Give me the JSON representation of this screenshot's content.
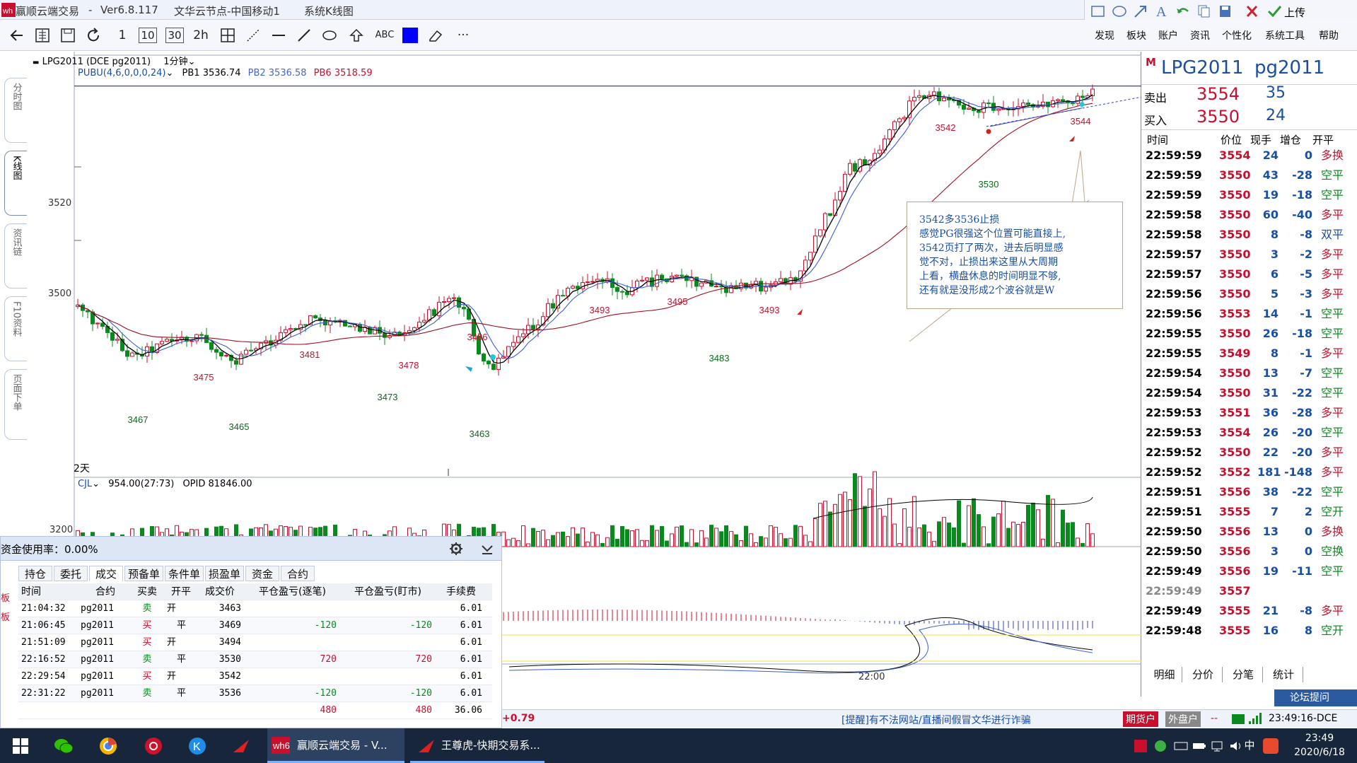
{
  "window": {
    "app_title": "赢顺云端交易",
    "separator": "-",
    "version": "Ver6.8.117",
    "node": "文华云节点-中国移动1",
    "view": "系统K线图"
  },
  "toolbar": {
    "buttons": [
      "1",
      "10",
      "30",
      "2h"
    ],
    "abc": "ABC",
    "more": "···",
    "menus": [
      "发现",
      "板块",
      "账户",
      "资讯",
      "个性化",
      "系统工具",
      "帮助"
    ],
    "upload": "上传"
  },
  "left_tabs": [
    "分时图",
    "K线图",
    "资讯链",
    "F10资料",
    "页面下单"
  ],
  "chart_header": {
    "symbol": "LPG2011 (DCE pg2011)",
    "period": "1分钟",
    "indicator": "PUBU(4,6,0,0,0,24)",
    "pb1": "PB1 3536.74",
    "pb2": "PB2 3536.58",
    "pb6": "PB6 3518.59",
    "days": "2天",
    "cjl": "CJL",
    "cjl_value": "954.00(27:73)",
    "opid": "OPID 81846.00",
    "y_3520": "3520",
    "y_3500": "3500",
    "vol_label": "3200",
    "time_label": "22:00"
  },
  "annotation": {
    "lines": [
      "3542多3536止损",
      "感觉PG很强这个位置可能直接上,",
      "3542页打了两次，进去后明显感",
      "觉不对，止损出来这里从大周期",
      "上看，横盘休息的时间明显不够,",
      "还有就是没形成2个波谷就是W"
    ]
  },
  "chart_data": {
    "type": "candlestick",
    "y_axis_ticks": [
      3500,
      3520
    ],
    "x_axis_ticks": [
      "22:00"
    ],
    "labeled_points": [
      {
        "label": "3467",
        "kind": "low"
      },
      {
        "label": "3475",
        "kind": "high"
      },
      {
        "label": "3465",
        "kind": "low"
      },
      {
        "label": "3481",
        "kind": "high"
      },
      {
        "label": "3473",
        "kind": "low"
      },
      {
        "label": "3478",
        "kind": "high"
      },
      {
        "label": "3486",
        "kind": "high"
      },
      {
        "label": "3463",
        "kind": "low"
      },
      {
        "label": "3493",
        "kind": "high"
      },
      {
        "label": "3495",
        "kind": "high"
      },
      {
        "label": "3483",
        "kind": "low"
      },
      {
        "label": "3493",
        "kind": "high"
      },
      {
        "label": "3542",
        "kind": "high"
      },
      {
        "label": "3530",
        "kind": "low"
      },
      {
        "label": "3544",
        "kind": "high"
      }
    ],
    "reference_line": 3542
  },
  "quote": {
    "market": "M",
    "name": "LPG2011",
    "code": "pg2011",
    "ask_label": "卖出",
    "ask_price": "3554",
    "ask_vol": "35",
    "bid_label": "买入",
    "bid_price": "3550",
    "bid_vol": "24",
    "cols": [
      "时间",
      "价位",
      "现手",
      "增仓",
      "开平"
    ],
    "ticks": [
      [
        "22:59:59",
        "3554",
        "24",
        "0",
        "多换"
      ],
      [
        "22:59:59",
        "3550",
        "43",
        "-28",
        "空平"
      ],
      [
        "22:59:59",
        "3550",
        "19",
        "-18",
        "空平"
      ],
      [
        "22:59:58",
        "3550",
        "60",
        "-40",
        "多平"
      ],
      [
        "22:59:58",
        "3550",
        "8",
        "-8",
        "双平"
      ],
      [
        "22:59:57",
        "3550",
        "3",
        "-2",
        "多平"
      ],
      [
        "22:59:57",
        "3550",
        "6",
        "-5",
        "多平"
      ],
      [
        "22:59:56",
        "3550",
        "5",
        "-3",
        "多平"
      ],
      [
        "22:59:56",
        "3553",
        "14",
        "-1",
        "空平"
      ],
      [
        "22:59:55",
        "3550",
        "26",
        "-18",
        "空平"
      ],
      [
        "22:59:55",
        "3549",
        "8",
        "-1",
        "多平"
      ],
      [
        "22:59:54",
        "3550",
        "13",
        "-7",
        "空平"
      ],
      [
        "22:59:54",
        "3550",
        "31",
        "-22",
        "空平"
      ],
      [
        "22:59:53",
        "3551",
        "36",
        "-28",
        "多平"
      ],
      [
        "22:59:53",
        "3554",
        "26",
        "-20",
        "空平"
      ],
      [
        "22:59:52",
        "3550",
        "22",
        "-20",
        "多平"
      ],
      [
        "22:59:52",
        "3552",
        "181",
        "-148",
        "多平"
      ],
      [
        "22:59:51",
        "3556",
        "38",
        "-22",
        "空平"
      ],
      [
        "22:59:51",
        "3555",
        "7",
        "2",
        "空开"
      ],
      [
        "22:59:50",
        "3556",
        "13",
        "0",
        "多换"
      ],
      [
        "22:59:50",
        "3556",
        "3",
        "0",
        "空换"
      ],
      [
        "22:59:49",
        "3556",
        "19",
        "-11",
        "空平"
      ],
      [
        "22:59:49",
        "3557",
        "",
        "",
        ""
      ],
      [
        "22:59:49",
        "3555",
        "21",
        "-8",
        "多平"
      ],
      [
        "22:59:48",
        "3555",
        "16",
        "8",
        "空开"
      ]
    ],
    "tabs": [
      "明细",
      "分价",
      "分笔",
      "统计"
    ]
  },
  "account_panel": {
    "usage": "资金使用率：0.00%",
    "tabs": [
      "持仓",
      "委托",
      "成交",
      "预备单",
      "条件单",
      "损盈单",
      "资金",
      "合约"
    ],
    "cols": [
      "时间",
      "合约",
      "买卖",
      "开平",
      "成交价",
      "平仓盈亏(逐笔)",
      "平仓盈亏(盯市)",
      "手续费"
    ],
    "rows": [
      [
        "21:04:32",
        "pg2011",
        "卖",
        "开",
        "3463",
        "",
        "",
        "6.01"
      ],
      [
        "21:06:45",
        "pg2011",
        "买",
        "平",
        "3469",
        "-120",
        "-120",
        "6.01"
      ],
      [
        "21:51:09",
        "pg2011",
        "买",
        "开",
        "3494",
        "",
        "",
        "6.01"
      ],
      [
        "22:16:52",
        "pg2011",
        "卖",
        "平",
        "3530",
        "720",
        "720",
        "6.01"
      ],
      [
        "22:29:54",
        "pg2011",
        "买",
        "开",
        "3542",
        "",
        "",
        "6.01"
      ],
      [
        "22:31:22",
        "pg2011",
        "卖",
        "平",
        "3536",
        "-120",
        "-120",
        "6.01"
      ]
    ],
    "totals": [
      "480",
      "480",
      "36.06"
    ]
  },
  "status": {
    "change": "+0.79",
    "notice": "[提醒]有不法网站/直播间假冒文华进行诈骗",
    "futures_acct": "期货户",
    "external_acct": "外盘户",
    "dash": "--",
    "clock": "23:49:16-DCE",
    "forum": "论坛提问"
  },
  "taskbar": {
    "task1": "赢顺云端交易 - V...",
    "task2": "王尊虎-快期交易系...",
    "ime": "中",
    "time": "23:49",
    "date": "2020/6/18"
  },
  "colors": {
    "up": "#c8102e",
    "down": "#0a8a1e",
    "blue": "#1a4fa0"
  }
}
